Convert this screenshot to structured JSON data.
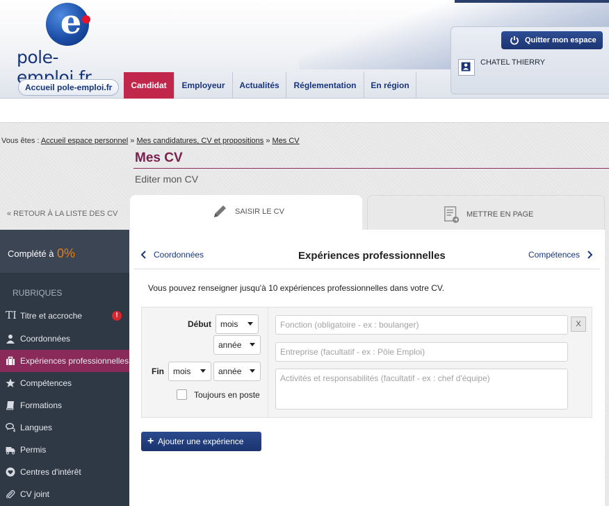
{
  "brand": {
    "logo_text": "pole-emploi.fr",
    "logo_letter": "e"
  },
  "nav": {
    "home": "Accueil pole-emploi.fr",
    "items": [
      "Candidat",
      "Employeur",
      "Actualités",
      "Réglementation",
      "En région"
    ],
    "active": "Candidat"
  },
  "user": {
    "quit_label": "Quitter mon espace",
    "name": "CHATEL THIERRY"
  },
  "breadcrumb": {
    "prefix": "Vous êtes : ",
    "links": [
      "Accueil espace personnel",
      "Mes candidatures, CV et propositions",
      "Mes CV"
    ],
    "separator": " » "
  },
  "page": {
    "title": "Mes CV",
    "subtitle": "Editer mon CV"
  },
  "back_link": "« RETOUR À LA LISTE DES CV",
  "tabs": [
    {
      "label": "SAISIR LE CV",
      "icon": "pencil-icon",
      "active": true
    },
    {
      "label": "METTRE EN PAGE",
      "icon": "document-layout-icon",
      "active": false
    }
  ],
  "sidebar": {
    "completion_label": "Complété à",
    "completion_value": "0%",
    "rubriques_title": "RUBRIQUES",
    "items": [
      {
        "label": "Titre et accroche",
        "icon": "text-icon",
        "alert": "!"
      },
      {
        "label": "Coordonnées",
        "icon": "user-icon"
      },
      {
        "label": "Expériences professionnelles",
        "icon": "briefcase-icon",
        "active": true
      },
      {
        "label": "Compétences",
        "icon": "star-icon"
      },
      {
        "label": "Formations",
        "icon": "book-icon"
      },
      {
        "label": "Langues",
        "icon": "speech-bubbles-icon"
      },
      {
        "label": "Permis",
        "icon": "truck-icon"
      },
      {
        "label": "Centres d'intérêt",
        "icon": "heart-icon"
      },
      {
        "label": "CV joint",
        "icon": "paperclip-icon"
      }
    ]
  },
  "section": {
    "prev": "Coordonnées",
    "title": "Expériences professionnelles",
    "next": "Compétences",
    "intro": "Vous pouvez renseigner jusqu'à 10 expériences professionnelles dans votre CV."
  },
  "form": {
    "start_label": "Début",
    "end_label": "Fin",
    "month": "mois",
    "year": "année",
    "ongoing": "Toujours en poste",
    "function_placeholder": "Fonction (obligatoire - ex : boulanger)",
    "company_placeholder": "Entreprise (facultatif - ex : Pôle Emploi)",
    "activities_placeholder": "Activités et responsabilités (facultatif - ex : chef d'équipe)",
    "delete_label": "X"
  },
  "add_button": "Ajouter une expérience",
  "colors": {
    "primary": "#17357c",
    "accent": "#c1264b",
    "active_side": "#8a2a5a",
    "completion": "#e57d15"
  }
}
